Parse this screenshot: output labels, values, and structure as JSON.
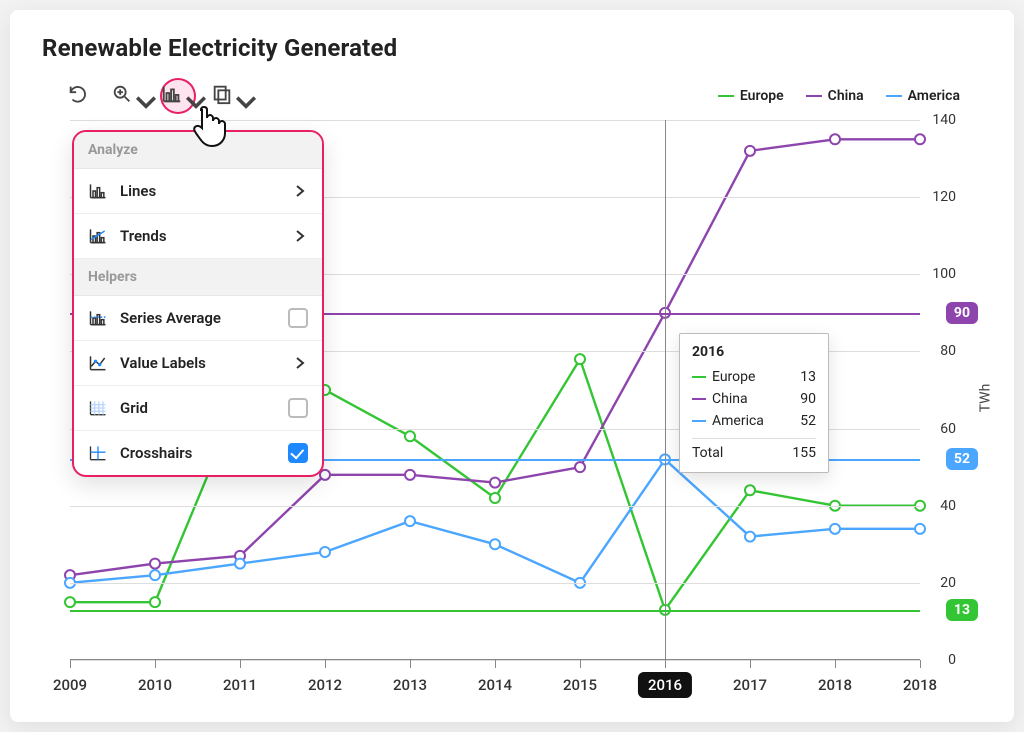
{
  "title": "Renewable Electricity Generated",
  "toolbar": {
    "undo_tip": "Undo",
    "zoom_tip": "Zoom",
    "analyze_tip": "Analyze",
    "copy_tip": "Copy"
  },
  "menu": {
    "header_analyze": "Analyze",
    "header_helpers": "Helpers",
    "lines": "Lines",
    "trends": "Trends",
    "series_average": "Series Average",
    "value_labels": "Value Labels",
    "grid": "Grid",
    "crosshairs": "Crosshairs"
  },
  "legend": {
    "europe": "Europe",
    "china": "China",
    "america": "America"
  },
  "colors": {
    "europe": "#34c534",
    "china": "#8e44ad",
    "america": "#4aa6ff"
  },
  "chart_data": {
    "type": "line",
    "title": "Renewable Electricity Generated",
    "xlabel": "",
    "ylabel": "TWh",
    "ylim": [
      0,
      140
    ],
    "categories": [
      "2009",
      "2010",
      "2011",
      "2012",
      "2013",
      "2014",
      "2015",
      "2016",
      "2017",
      "2018",
      "2018"
    ],
    "series": [
      {
        "name": "Europe",
        "color": "#34c534",
        "values": [
          15,
          15,
          68,
          70,
          58,
          42,
          78,
          13,
          44,
          40,
          40
        ]
      },
      {
        "name": "China",
        "color": "#8e44ad",
        "values": [
          22,
          25,
          27,
          48,
          48,
          46,
          50,
          90,
          132,
          135,
          135
        ]
      },
      {
        "name": "America",
        "color": "#4aa6ff",
        "values": [
          20,
          22,
          25,
          28,
          36,
          30,
          20,
          52,
          32,
          34,
          34
        ]
      }
    ],
    "grid": true,
    "crosshair_category": "2016"
  },
  "tooltip": {
    "title": "2016",
    "rows": [
      {
        "name": "Europe",
        "value": 13
      },
      {
        "name": "China",
        "value": 90
      },
      {
        "name": "America",
        "value": 52
      }
    ],
    "total_label": "Total",
    "total_value": 155
  },
  "y_ticks": [
    0,
    20,
    40,
    60,
    80,
    100,
    120,
    140
  ],
  "end_badges": {
    "china": 90,
    "america": 52,
    "europe": 13
  },
  "y_axis_title": "TWh"
}
